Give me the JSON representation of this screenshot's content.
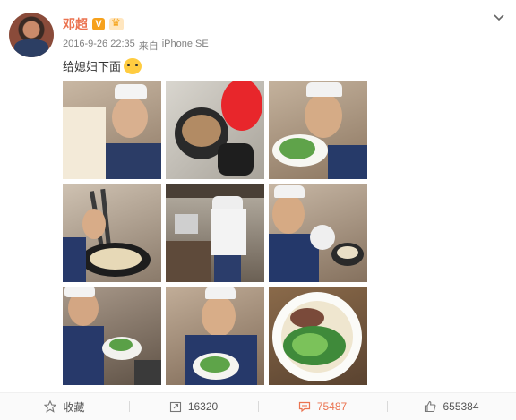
{
  "post": {
    "author": "邓超",
    "time": "2016-9-26 22:35",
    "source_prefix": "来自",
    "device": "iPhone SE",
    "text": "给媳妇下面",
    "emoji": "cat-face-emoji",
    "photos": [
      "photo-noodles-holding",
      "photo-pot-with-spoon",
      "photo-eating-vegetables",
      "photo-cooking-noodles",
      "photo-kitchen-back-view",
      "photo-shouting-at-stove",
      "photo-holding-bowl-side",
      "photo-holding-bowl-front",
      "photo-noodle-bowl-topdown"
    ]
  },
  "footer": {
    "favorite_label": "收藏",
    "repost_count": "16320",
    "comment_count": "75487",
    "like_count": "655384"
  },
  "colors": {
    "author": "#eb7350",
    "comment_accent": "#eb7350",
    "meta": "#808080"
  }
}
